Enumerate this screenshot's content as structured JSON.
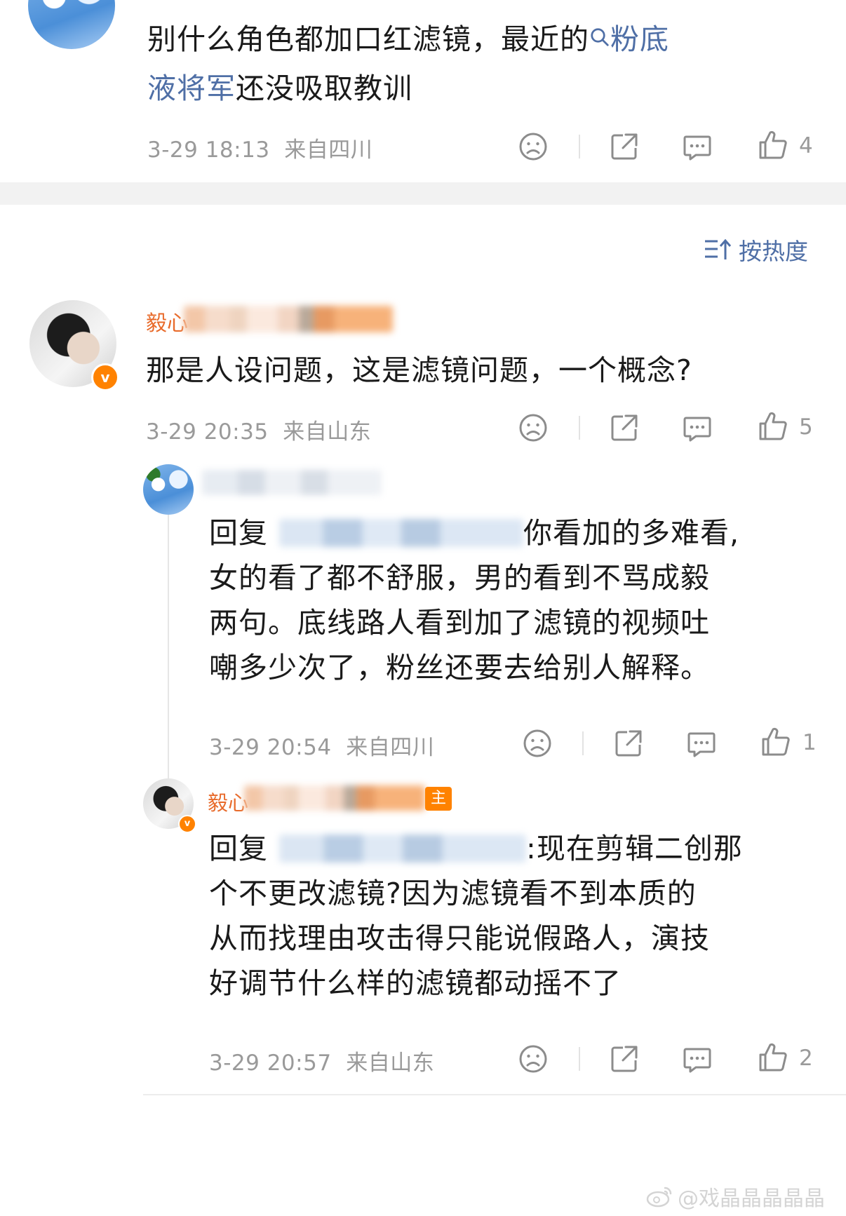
{
  "top_comment": {
    "text_prefix": "别什么角色都加口红滤镜，最近的",
    "topic_link": "粉底",
    "topic_link_line2": "液将军",
    "text_suffix": "还没吸取教训",
    "time": "3-29 18:13",
    "location": "来自四川",
    "like_count": "4"
  },
  "sort": {
    "label": "按热度"
  },
  "comments": [
    {
      "author_partial": "毅心",
      "text": "那是人设问题，这是滤镜问题，一个概念?",
      "time": "3-29 20:35",
      "location": "来自山东",
      "like_count": "5"
    }
  ],
  "replies": [
    {
      "reply_prefix": "回复",
      "text_line1_end": "你看加的多难看,",
      "text_lines": [
        "女的看了都不舒服，男的看到不骂成毅",
        "两句。底线路人看到加了滤镜的视频吐",
        "嘲多少次了，粉丝还要去给别人解释。"
      ],
      "time": "3-29 20:54",
      "location": "来自四川",
      "like_count": "1"
    },
    {
      "author_partial": "毅心",
      "host_badge": "主",
      "reply_prefix": "回复",
      "text_line1_end": ":现在剪辑二创那",
      "text_lines": [
        "个不更改滤镜?因为滤镜看不到本质的",
        "从而找理由攻击得只能说假路人，演技",
        "好调节什么样的滤镜都动摇不了"
      ],
      "time": "3-29 20:57",
      "location": "来自山东",
      "like_count": "2"
    }
  ],
  "watermark": "@戏晶晶晶晶晶",
  "colors": {
    "link": "#4f6fa6",
    "verified": "#ff8200",
    "meta": "#9a9a9a"
  }
}
